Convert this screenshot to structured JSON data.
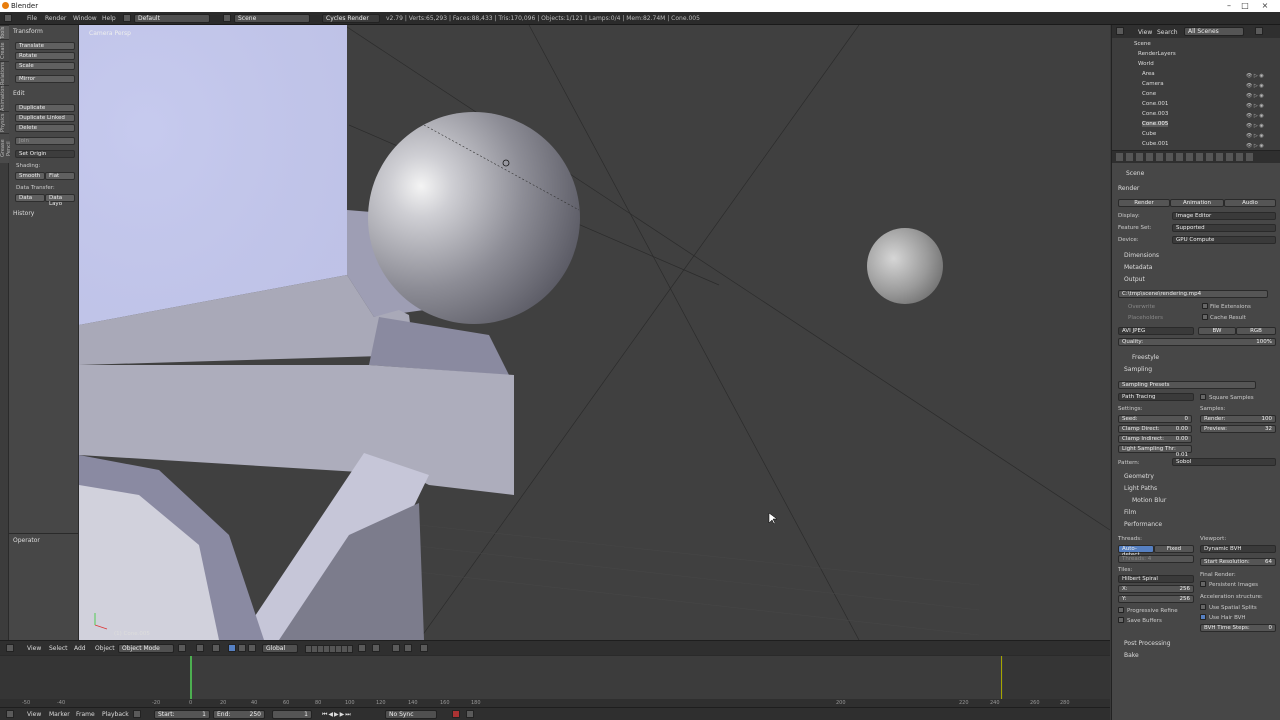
{
  "window": {
    "title": "Blender"
  },
  "infobar": {
    "menus": [
      "File",
      "Render",
      "Window",
      "Help"
    ],
    "layout": "Default",
    "scene": "Scene",
    "engine": "Cycles Render",
    "stats": "v2.79 | Verts:65,293 | Faces:88,433 | Tris:170,096 | Objects:1/121 | Lamps:0/4 | Mem:82.74M | Cone.005"
  },
  "toolshelf": {
    "tabs": [
      "Tools",
      "Create",
      "Relations",
      "Animation",
      "Physics",
      "Grease Pencil"
    ],
    "transform_header": "Transform",
    "transform": [
      "Translate",
      "Rotate",
      "Scale",
      "Mirror"
    ],
    "edit_header": "Edit",
    "edit": [
      "Duplicate",
      "Duplicate Linked",
      "Delete",
      "Join",
      "Set Origin"
    ],
    "shading_label": "Shading:",
    "shading": [
      "Smooth",
      "Flat"
    ],
    "data_transfer_label": "Data Transfer:",
    "data_transfer": [
      "Data",
      "Data Layo"
    ],
    "history": "History",
    "operator": "Operator"
  },
  "viewport": {
    "view_label": "Camera Persp",
    "object_label": "(1) Cone.005"
  },
  "viewport_header": {
    "menus": [
      "View",
      "Select",
      "Add",
      "Object"
    ],
    "mode": "Object Mode",
    "orientation": "Global"
  },
  "outliner": {
    "menus": [
      "View",
      "Search"
    ],
    "scene_filter": "All Scenes",
    "items": [
      "Scene",
      "RenderLayers",
      "World",
      "Area",
      "Camera",
      "Cone",
      "Cone.001",
      "Cone.003",
      "Cone.005",
      "Cube",
      "Cube.001"
    ]
  },
  "properties": {
    "context": "Scene",
    "render_header": "Render",
    "render_buttons": [
      "Render",
      "Animation",
      "Audio"
    ],
    "display_label": "Display:",
    "display": "Image Editor",
    "feature_label": "Feature Set:",
    "feature": "Supported",
    "device_label": "Device:",
    "device": "GPU Compute",
    "dimensions": "Dimensions",
    "metadata": "Metadata",
    "output": "Output",
    "output_path": "C:\\tmp\\scene\\rendering.mp4",
    "overwrite": "Overwrite",
    "placeholders": "Placeholders",
    "file_extensions": "File Extensions",
    "cache_result": "Cache Result",
    "format": "AVI JPEG",
    "bw": "BW",
    "rgb": "RGB",
    "quality_label": "Quality:",
    "quality": "100%",
    "freestyle": "Freestyle",
    "sampling": "Sampling",
    "sampling_presets": "Sampling Presets",
    "integrator": "Path Tracing",
    "square_samples": "Square Samples",
    "settings_label": "Settings:",
    "samples_label": "Samples:",
    "seed_label": "Seed:",
    "seed": "0",
    "clamp_direct_label": "Clamp Direct:",
    "clamp_direct": "0.00",
    "clamp_indirect_label": "Clamp Indirect:",
    "clamp_indirect": "0.00",
    "light_thr_label": "Light Sampling Thr:",
    "light_thr": "0.01",
    "render_samples_label": "Render:",
    "render_samples": "100",
    "preview_samples_label": "Preview:",
    "preview_samples": "32",
    "pattern_label": "Pattern:",
    "pattern": "Sobol",
    "geometry": "Geometry",
    "light_paths": "Light Paths",
    "motion_blur": "Motion Blur",
    "film": "Film",
    "performance": "Performance",
    "threads_label": "Threads:",
    "threads_auto": "Auto-detect",
    "threads_fixed": "Fixed",
    "threads_field": "Threads: 4",
    "viewport_label": "Viewport:",
    "viewport_bvh": "Dynamic BVH",
    "start_res_label": "Start Resolution:",
    "start_res": "64",
    "tiles_label": "Tiles:",
    "tile_order": "Hilbert Spiral",
    "tile_x_label": "X:",
    "tile_x": "256",
    "tile_y_label": "Y:",
    "tile_y": "256",
    "final_render_label": "Final Render:",
    "persistent_images": "Persistent Images",
    "accel_label": "Acceleration structure:",
    "spatial_splits": "Use Spatial Splits",
    "hair_bvh": "Use Hair BVH",
    "bvh_steps_label": "BVH Time Steps:",
    "bvh_steps": "0",
    "progressive_refine": "Progressive Refine",
    "save_buffers": "Save Buffers",
    "post_processing": "Post Processing",
    "bake": "Bake"
  },
  "timeline": {
    "ticks": [
      "-50",
      "-40",
      "-20",
      "0",
      "20",
      "40",
      "60",
      "80",
      "100",
      "120",
      "140",
      "160",
      "180",
      "200",
      "220",
      "240",
      "260",
      "280"
    ],
    "menus": [
      "View",
      "Marker",
      "Frame",
      "Playback"
    ],
    "start_label": "Start:",
    "start": "1",
    "end_label": "End:",
    "end": "250",
    "current": "1",
    "sync": "No Sync"
  }
}
